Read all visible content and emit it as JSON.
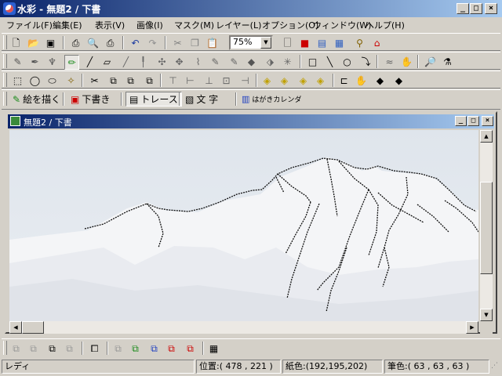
{
  "window": {
    "title": "水彩 - 無題2 / 下書"
  },
  "menu": [
    "ファイル(F)",
    "編集(E)",
    "表示(V)",
    "画像(I)",
    "マスク(M)",
    "レイヤー(L)",
    "オプション(O)",
    "ウィンドウ(W)",
    "ヘルプ(H)"
  ],
  "toolbar1": {
    "zoom": "75%"
  },
  "modes": {
    "paint": "絵を描く",
    "draft": "下書き",
    "trace": "トレース",
    "text": "文 字",
    "calendar": "はがきカレンダ"
  },
  "document": {
    "title": "無題2 / 下書"
  },
  "status": {
    "state": "レディ",
    "position": "位置:( 478 , 221 )",
    "paper_color": "紙色:(192,195,202)",
    "pen_color": "筆色:( 63 , 63 , 63 )"
  },
  "colors": {
    "titlebar": "#0a246a",
    "chrome": "#d4d0c8",
    "canvas": "#e9edf2",
    "accent_red": "#cc0000"
  }
}
